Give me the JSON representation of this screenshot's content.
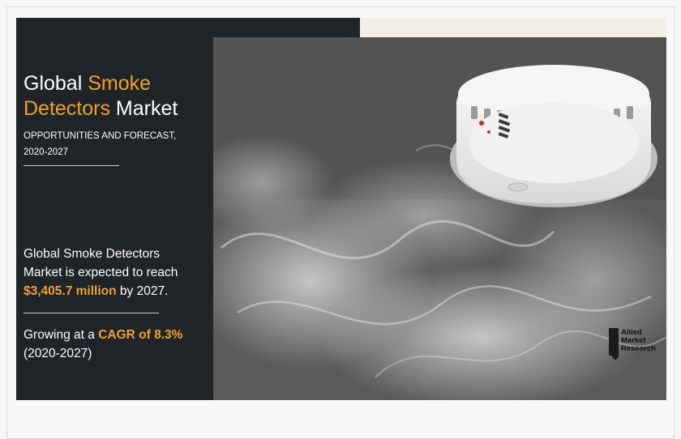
{
  "banner": {
    "title_part1": "Global ",
    "title_part2": "Smoke",
    "title_part3": "Detectors",
    "title_part4": " Market",
    "subtitle_line1": "OPPORTUNITIES AND FORECAST,",
    "subtitle_line2": "2020-2027",
    "desc_line1": "Global Smoke Detectors",
    "desc_line2": "Market is expected to reach",
    "desc_value": "$3,405.7 million",
    "desc_suffix": " by 2027.",
    "growth_prefix": "Growing at a ",
    "growth_value": "CAGR of 8.3%",
    "growth_period": "(2020-2027)",
    "logo_line1": "Allied",
    "logo_line2": "Market",
    "logo_line3": "Research"
  },
  "colors": {
    "panel": "#1f2428",
    "accent": "#f2a11b",
    "text": "#ffffff"
  }
}
